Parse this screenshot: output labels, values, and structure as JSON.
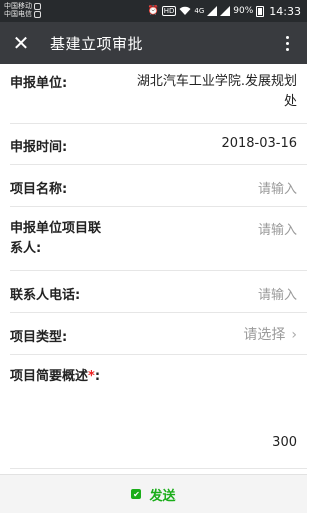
{
  "statusbar": {
    "carrier1": "中国移动",
    "carrier2": "中国电信",
    "hd": "HD",
    "network": "4G",
    "battery_pct": "90%",
    "time": "14:33"
  },
  "titlebar": {
    "title": "基建立项审批"
  },
  "form": {
    "unit_label": "申报单位:",
    "unit_value_line1": "湖北汽车工业学院.发展规划",
    "unit_value_line2": "处",
    "time_label": "申报时间:",
    "time_value": "2018-03-16",
    "project_name_label": "项目名称:",
    "project_name_placeholder": "请输入",
    "contact_label_line1": "申报单位项目联",
    "contact_label_line2": "系人:",
    "contact_placeholder": "请输入",
    "phone_label": "联系人电话:",
    "phone_placeholder": "请输入",
    "type_label": "项目类型:",
    "type_value": "请选择",
    "summary_label": "项目简要概述",
    "summary_required": "*",
    "summary_colon": ":",
    "summary_count": "300"
  },
  "footer": {
    "send_label": "发送"
  }
}
